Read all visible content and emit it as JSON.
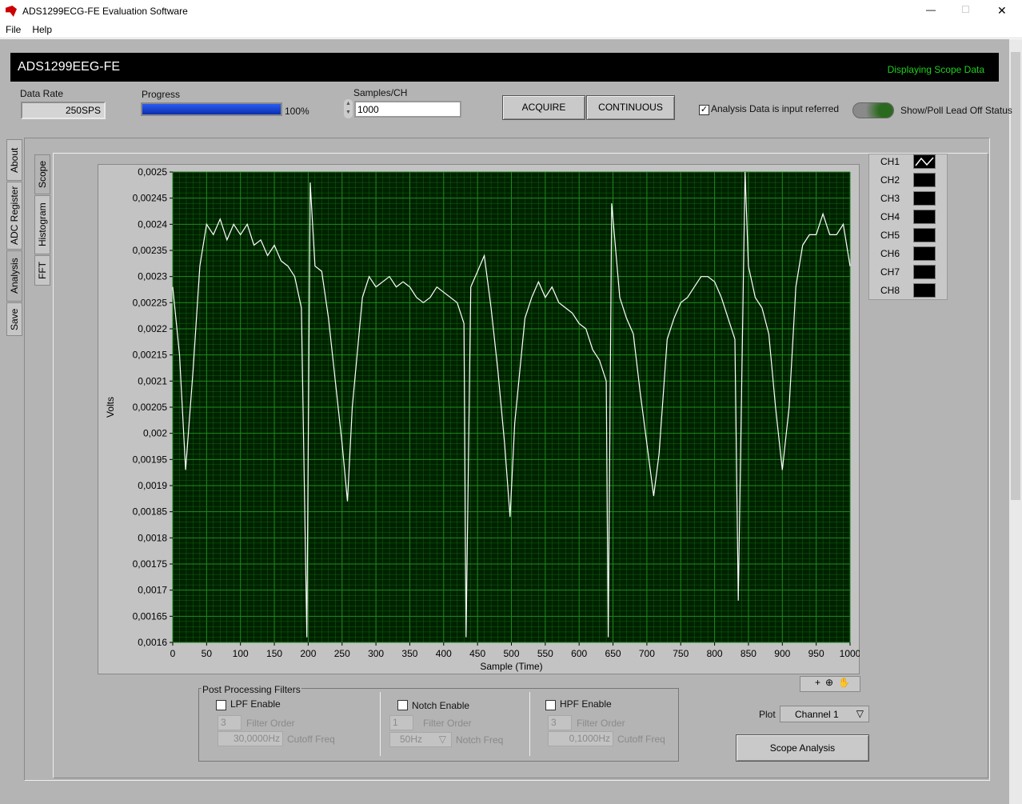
{
  "window": {
    "title": "ADS1299ECG-FE Evaluation Software",
    "minimize": "—",
    "maximize": "☐",
    "close": "✕"
  },
  "menu": [
    {
      "label": "File"
    },
    {
      "label": "Help"
    }
  ],
  "header": {
    "title": "ADS1299EEG-FE",
    "status": "Displaying Scope Data",
    "status_color": "#1fd01f"
  },
  "controls": {
    "data_rate_label": "Data Rate",
    "data_rate": "250SPS",
    "progress_label": "Progress",
    "progress_percent": 100,
    "progress_text": "100%",
    "progress_color": "#1040d0",
    "samples_label": "Samples/CH",
    "samples_value": "1000",
    "acquire": "ACQUIRE",
    "continuous": "CONTINUOUS",
    "analysis_checkbox": "Analysis Data is input referred",
    "analysis_checked": true,
    "lead_off": "Show/Poll Lead Off Status"
  },
  "side_tabs": [
    {
      "label": "About"
    },
    {
      "label": "ADC Register"
    },
    {
      "label": "Analysis"
    },
    {
      "label": "Save"
    }
  ],
  "sub_tabs": [
    {
      "label": "Scope"
    },
    {
      "label": "Histogram"
    },
    {
      "label": "FFT"
    }
  ],
  "channels": [
    {
      "label": "CH1",
      "active": true
    },
    {
      "label": "CH2"
    },
    {
      "label": "CH3"
    },
    {
      "label": "CH4"
    },
    {
      "label": "CH5"
    },
    {
      "label": "CH6"
    },
    {
      "label": "CH7"
    },
    {
      "label": "CH8"
    }
  ],
  "filters": {
    "group_label": "Post Processing Filters",
    "lpf": {
      "enable": "LPF Enable",
      "order": "3",
      "order_label": "Filter Order",
      "freq": "30,0000Hz",
      "freq_label": "Cutoff Freq"
    },
    "notch": {
      "enable": "Notch Enable",
      "order": "1",
      "order_label": "Filter Order",
      "freq": "50Hz",
      "freq_label": "Notch Freq"
    },
    "hpf": {
      "enable": "HPF Enable",
      "order": "3",
      "order_label": "Filter Order",
      "freq": "0,1000Hz",
      "freq_label": "Cutoff Freq"
    }
  },
  "plot_select": {
    "label": "Plot",
    "value": "Channel 1"
  },
  "scope_analysis": "Scope Analysis",
  "chart_data": {
    "type": "line",
    "xlabel": "Sample (Time)",
    "ylabel": "Volts",
    "xlim": [
      0,
      1000
    ],
    "ylim": [
      0.0016,
      0.0025
    ],
    "xticks": [
      "0",
      "50",
      "100",
      "150",
      "200",
      "250",
      "300",
      "350",
      "400",
      "450",
      "500",
      "550",
      "600",
      "650",
      "700",
      "750",
      "800",
      "850",
      "900",
      "950",
      "1000"
    ],
    "yticks": [
      "0,0025",
      "0,00245",
      "0,0024",
      "0,00235",
      "0,0023",
      "0,00225",
      "0,0022",
      "0,00215",
      "0,0021",
      "0,00205",
      "0,002",
      "0,00195",
      "0,0019",
      "0,00185",
      "0,0018",
      "0,00175",
      "0,0017",
      "0,00165",
      "0,0016"
    ],
    "grid": true,
    "background": "#002200",
    "grid_color": "#1f8a1f",
    "line_color": "#ffffff",
    "x": [
      0,
      10,
      19,
      30,
      40,
      50,
      60,
      70,
      80,
      90,
      100,
      110,
      120,
      130,
      140,
      150,
      160,
      170,
      180,
      190,
      198,
      203,
      210,
      220,
      230,
      240,
      250,
      258,
      265,
      280,
      290,
      300,
      310,
      320,
      330,
      340,
      350,
      360,
      370,
      380,
      390,
      400,
      410,
      420,
      430,
      433,
      440,
      450,
      460,
      470,
      480,
      490,
      498,
      505,
      520,
      530,
      540,
      550,
      560,
      570,
      580,
      590,
      600,
      610,
      620,
      630,
      640,
      643,
      648,
      660,
      670,
      680,
      690,
      700,
      710,
      718,
      730,
      740,
      750,
      760,
      770,
      780,
      790,
      800,
      810,
      820,
      830,
      835,
      845,
      850,
      860,
      870,
      880,
      890,
      900,
      910,
      920,
      930,
      940,
      950,
      960,
      970,
      980,
      990,
      1000
    ],
    "y": [
      0.00228,
      0.00215,
      0.00193,
      0.00212,
      0.00232,
      0.0024,
      0.00238,
      0.00241,
      0.00237,
      0.0024,
      0.00238,
      0.0024,
      0.00236,
      0.00237,
      0.00234,
      0.00236,
      0.00233,
      0.00232,
      0.0023,
      0.00224,
      0.00161,
      0.00248,
      0.00232,
      0.00231,
      0.00222,
      0.0021,
      0.00198,
      0.00187,
      0.00205,
      0.00226,
      0.0023,
      0.00228,
      0.00229,
      0.0023,
      0.00228,
      0.00229,
      0.00228,
      0.00226,
      0.00225,
      0.00226,
      0.00228,
      0.00227,
      0.00226,
      0.00225,
      0.00221,
      0.00161,
      0.00228,
      0.00231,
      0.00234,
      0.00224,
      0.00212,
      0.00198,
      0.00184,
      0.00202,
      0.00222,
      0.00226,
      0.00229,
      0.00226,
      0.00228,
      0.00225,
      0.00224,
      0.00223,
      0.00221,
      0.0022,
      0.00216,
      0.00214,
      0.0021,
      0.00161,
      0.00244,
      0.00226,
      0.00222,
      0.00219,
      0.00208,
      0.00198,
      0.00188,
      0.00196,
      0.00218,
      0.00222,
      0.00225,
      0.00226,
      0.00228,
      0.0023,
      0.0023,
      0.00229,
      0.00226,
      0.00222,
      0.00218,
      0.00168,
      0.0025,
      0.00232,
      0.00226,
      0.00224,
      0.00219,
      0.00205,
      0.00193,
      0.00205,
      0.00228,
      0.00236,
      0.00238,
      0.00238,
      0.00242,
      0.00238,
      0.00238,
      0.0024,
      0.00232
    ]
  }
}
